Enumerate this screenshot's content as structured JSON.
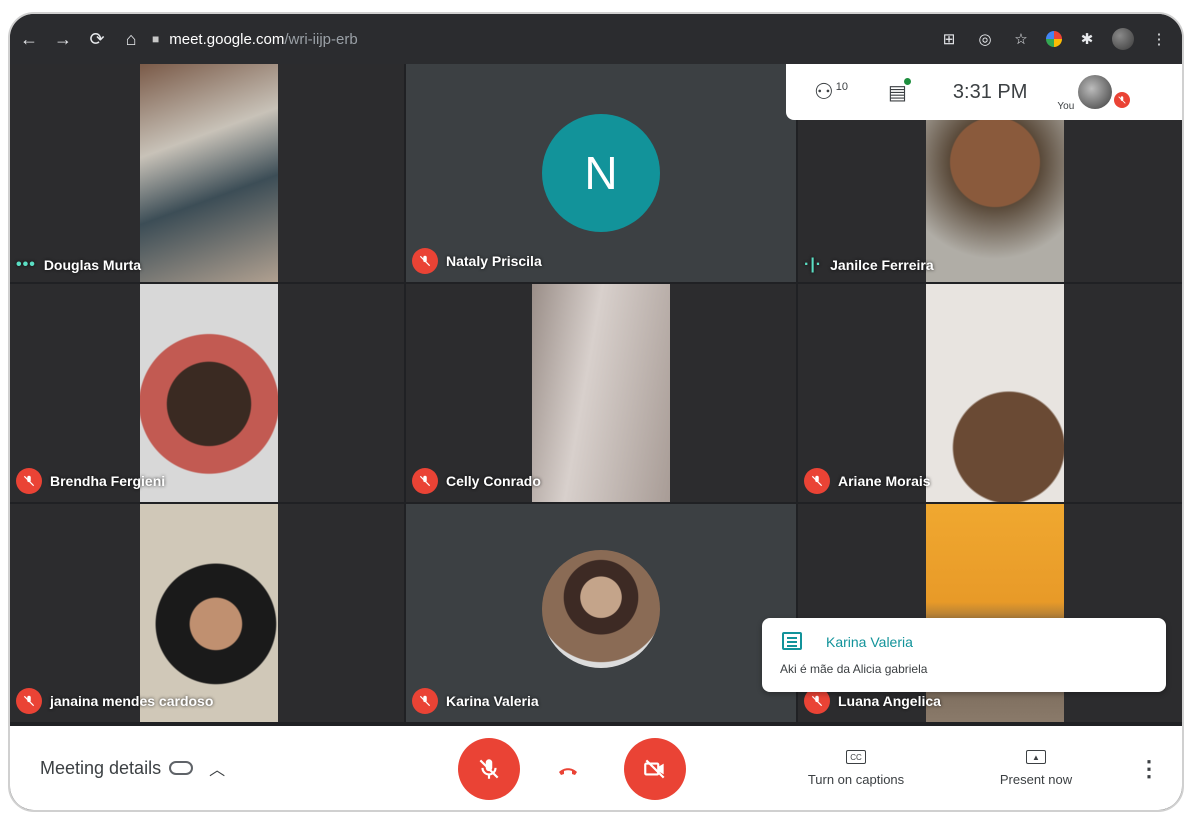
{
  "browser": {
    "url_host": "meet.google.com",
    "url_path": "/wri-iijp-erb"
  },
  "top_panel": {
    "participant_count": "10",
    "time": "3:31 PM",
    "you_label": "You"
  },
  "participants": [
    {
      "name": "Douglas Murta",
      "muted": false,
      "speaking": true
    },
    {
      "name": "Nataly Priscila",
      "muted": true,
      "avatar_letter": "N"
    },
    {
      "name": "Janilce Ferreira",
      "muted": false,
      "speaking": true
    },
    {
      "name": "Brendha Fergieni",
      "muted": true
    },
    {
      "name": "Celly Conrado",
      "muted": true
    },
    {
      "name": "Ariane Morais",
      "muted": true
    },
    {
      "name": "janaina mendes cardoso",
      "muted": true
    },
    {
      "name": "Karina Valeria",
      "muted": true
    },
    {
      "name": "Luana Angelica",
      "muted": true
    }
  ],
  "chat_toast": {
    "sender": "Karina Valeria",
    "message": "Aki é mãe da Alicia gabriela"
  },
  "bottom_bar": {
    "meeting_details": "Meeting details",
    "captions_label": "Turn on captions",
    "captions_icon": "CC",
    "present_label": "Present now"
  },
  "colors": {
    "accent_teal": "#12939a",
    "mute_red": "#ea4335",
    "tile_bg": "#3c4043"
  }
}
